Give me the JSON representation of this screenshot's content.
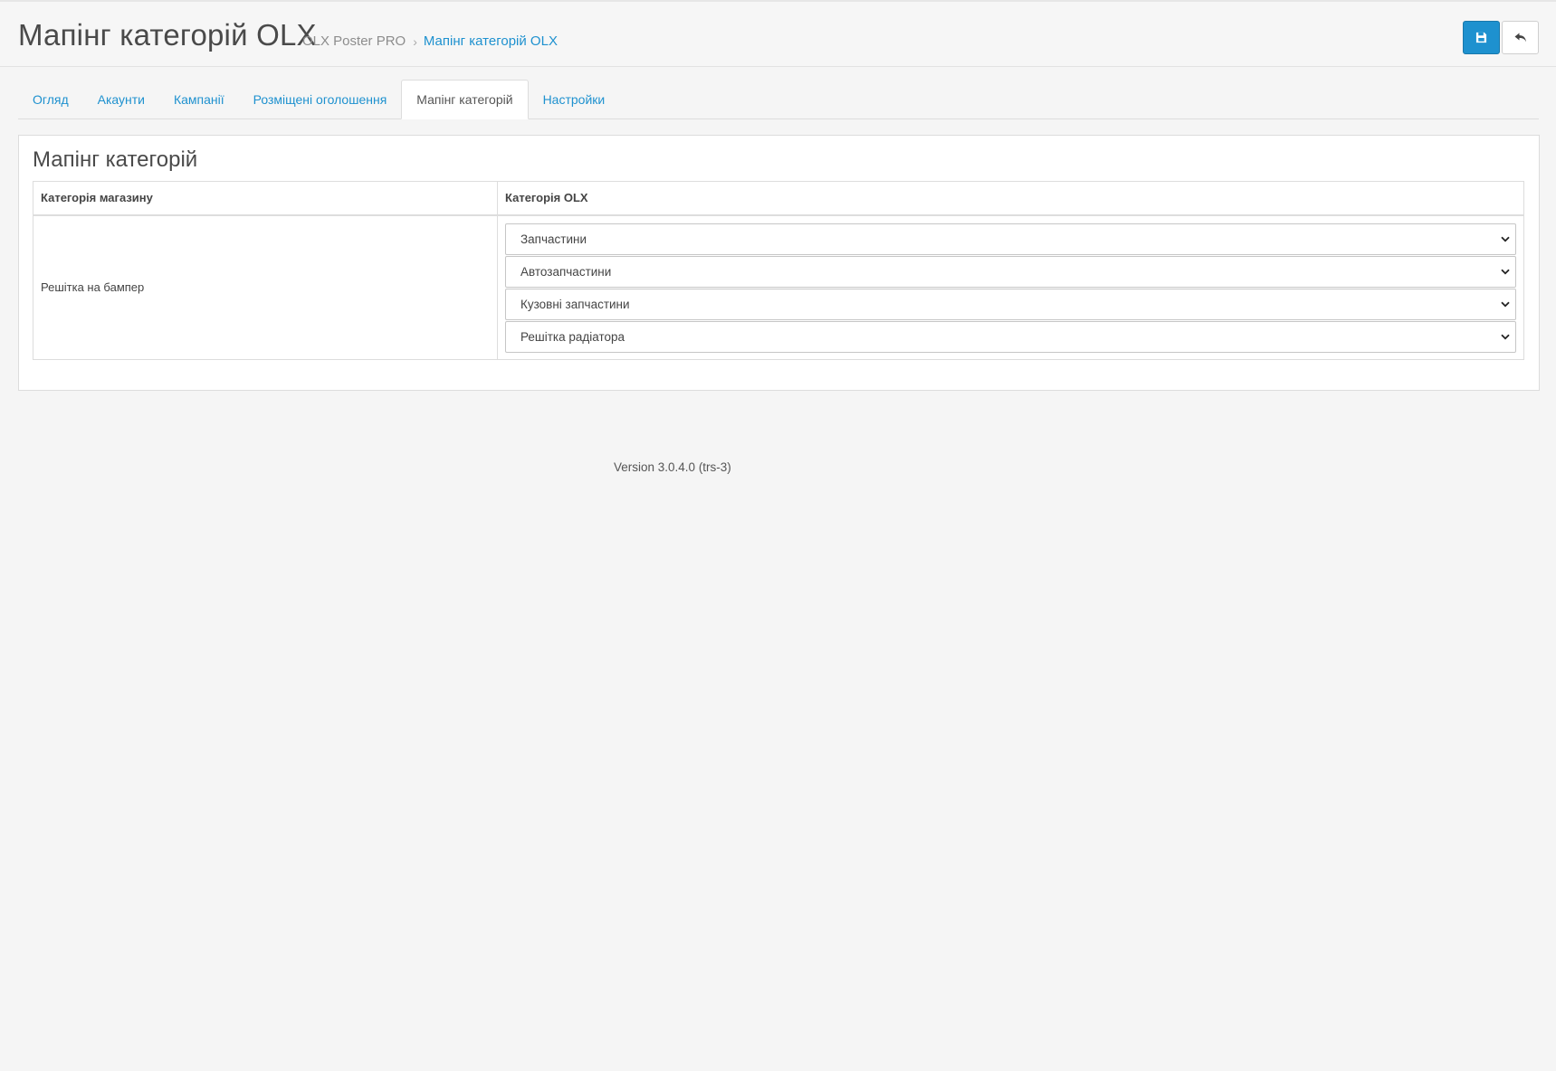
{
  "header": {
    "title": "Мапінг категорій OLX",
    "breadcrumb": {
      "root": "OLX Poster PRO",
      "separator": "›",
      "current": "Мапінг категорій OLX"
    },
    "save_icon": "floppy-disk-icon",
    "back_icon": "reply-arrow-icon",
    "accent_color": "#1e91cf"
  },
  "tabs": [
    {
      "label": "Огляд",
      "active": false
    },
    {
      "label": "Акаунти",
      "active": false
    },
    {
      "label": "Кампанії",
      "active": false
    },
    {
      "label": "Розміщені оголошення",
      "active": false
    },
    {
      "label": "Мапінг категорій",
      "active": true
    },
    {
      "label": "Настройки",
      "active": false
    }
  ],
  "panel": {
    "title": "Мапінг категорій",
    "table": {
      "headers": [
        "Категорія магазину",
        "Категорія OLX"
      ],
      "rows": [
        {
          "shop_category": "Решітка на бампер",
          "olx_selects": [
            "Запчастини",
            "Автозапчастини",
            "Кузовні запчастини",
            "Решітка радіатора"
          ]
        }
      ]
    }
  },
  "footer": {
    "version": "Version 3.0.4.0 (trs-3)"
  }
}
